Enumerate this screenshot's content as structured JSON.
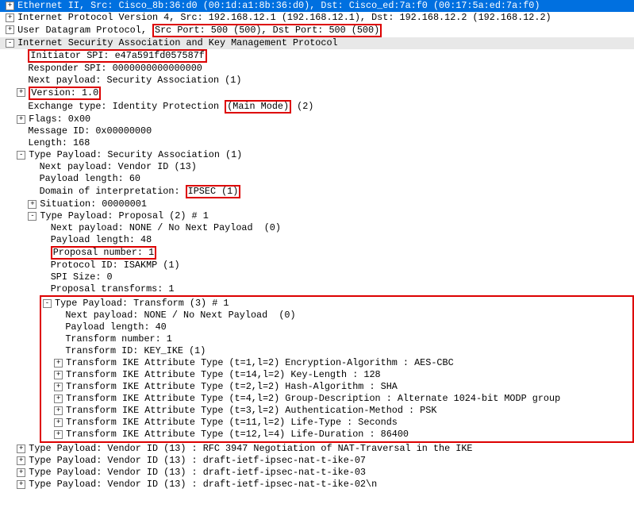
{
  "eth": "Ethernet II, Src: Cisco_8b:36:d0 (00:1d:a1:8b:36:d0), Dst: Cisco_ed:7a:f0 (00:17:5a:ed:7a:f0)",
  "ip": "Internet Protocol Version 4, Src: 192.168.12.1 (192.168.12.1), Dst: 192.168.12.2 (192.168.12.2)",
  "udp_pre": "User Datagram Protocol, ",
  "udp_hl": "Src Port: 500 (500), Dst Port: 500 (500)",
  "isakmp": "Internet Security Association and Key Management Protocol",
  "ispi": "Initiator SPI: e47a591fd057587f",
  "rspi": "Responder SPI: 0000000000000000",
  "nextp": "Next payload: Security Association (1)",
  "ver": "Version: 1.0",
  "exch_pre": "Exchange type: Identity Protection ",
  "exch_hl": "(Main Mode)",
  "exch_post": " (2)",
  "flags": "Flags: 0x00",
  "msgid": "Message ID: 0x00000000",
  "len": "Length: 168",
  "tp_sa": "Type Payload: Security Association (1)",
  "sa_next": "Next payload: Vendor ID (13)",
  "sa_plen": "Payload length: 60",
  "doi_pre": "Domain of interpretation: ",
  "doi_hl": "IPSEC (1)",
  "sit": "Situation: 00000001",
  "tp_prop": "Type Payload: Proposal (2) # 1",
  "pr_next": "Next payload: NONE / No Next Payload  (0)",
  "pr_plen": "Payload length: 48",
  "pr_num": "Proposal number: 1",
  "pr_proto": "Protocol ID: ISAKMP (1)",
  "pr_spi": "SPI Size: 0",
  "pr_t": "Proposal transforms: 1",
  "tp_tr": "Type Payload: Transform (3) # 1",
  "tr_next": "Next payload: NONE / No Next Payload  (0)",
  "tr_plen": "Payload length: 40",
  "tr_num": "Transform number: 1",
  "tr_id": "Transform ID: KEY_IKE (1)",
  "tr_a1": "Transform IKE Attribute Type (t=1,l=2) Encryption-Algorithm : AES-CBC",
  "tr_a2": "Transform IKE Attribute Type (t=14,l=2) Key-Length : 128",
  "tr_a3": "Transform IKE Attribute Type (t=2,l=2) Hash-Algorithm : SHA",
  "tr_a4": "Transform IKE Attribute Type (t=4,l=2) Group-Description : Alternate 1024-bit MODP group",
  "tr_a5": "Transform IKE Attribute Type (t=3,l=2) Authentication-Method : PSK",
  "tr_a6": "Transform IKE Attribute Type (t=11,l=2) Life-Type : Seconds",
  "tr_a7": "Transform IKE Attribute Type (t=12,l=4) Life-Duration : 86400",
  "vid1": "Type Payload: Vendor ID (13) : RFC 3947 Negotiation of NAT-Traversal in the IKE",
  "vid2": "Type Payload: Vendor ID (13) : draft-ietf-ipsec-nat-t-ike-07",
  "vid3": "Type Payload: Vendor ID (13) : draft-ietf-ipsec-nat-t-ike-03",
  "vid4": "Type Payload: Vendor ID (13) : draft-ietf-ipsec-nat-t-ike-02\\n",
  "plus": "+",
  "minus": "-"
}
